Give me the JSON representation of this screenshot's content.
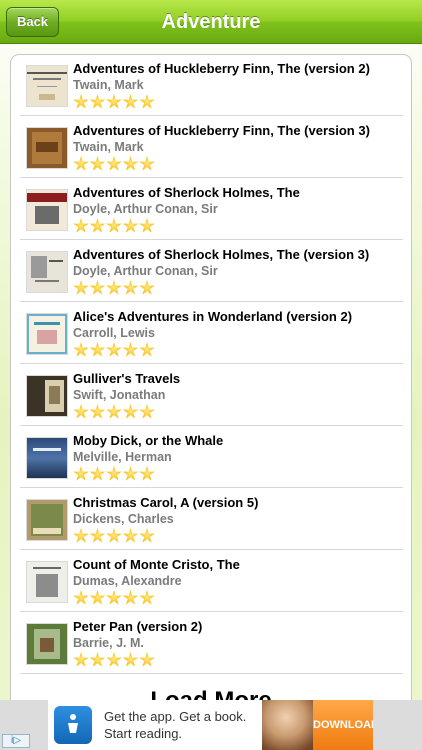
{
  "navbar": {
    "title": "Adventure",
    "back_label": "Back"
  },
  "books": [
    {
      "title": "Adventures of Huckleberry Finn, The (version 2)",
      "author": "Twain, Mark",
      "rating": 5
    },
    {
      "title": "Adventures of Huckleberry Finn, The (version 3)",
      "author": "Twain, Mark",
      "rating": 5
    },
    {
      "title": "Adventures of Sherlock Holmes, The",
      "author": "Doyle, Arthur Conan, Sir",
      "rating": 5
    },
    {
      "title": "Adventures of Sherlock Holmes, The (version 3)",
      "author": "Doyle, Arthur Conan, Sir",
      "rating": 5
    },
    {
      "title": "Alice's Adventures in Wonderland (version 2)",
      "author": "Carroll, Lewis",
      "rating": 5
    },
    {
      "title": "Gulliver's Travels",
      "author": "Swift, Jonathan",
      "rating": 5
    },
    {
      "title": "Moby Dick, or the Whale",
      "author": "Melville, Herman",
      "rating": 5
    },
    {
      "title": "Christmas Carol, A (version 5)",
      "author": "Dickens, Charles",
      "rating": 5
    },
    {
      "title": "Count of Monte Cristo, The",
      "author": "Dumas, Alexandre",
      "rating": 5
    },
    {
      "title": "Peter Pan (version 2)",
      "author": "Barrie, J. M.",
      "rating": 5
    }
  ],
  "load_more_label": "Load More",
  "ad": {
    "line1": "Get the app. Get a book.",
    "line2": "Start reading.",
    "cta": "DOWNLOAD",
    "adchoices_label": "i▷"
  },
  "colors": {
    "navbar_green": "#7fc21a",
    "star_gold": "#f5c21a",
    "download_orange": "#f07b10"
  }
}
